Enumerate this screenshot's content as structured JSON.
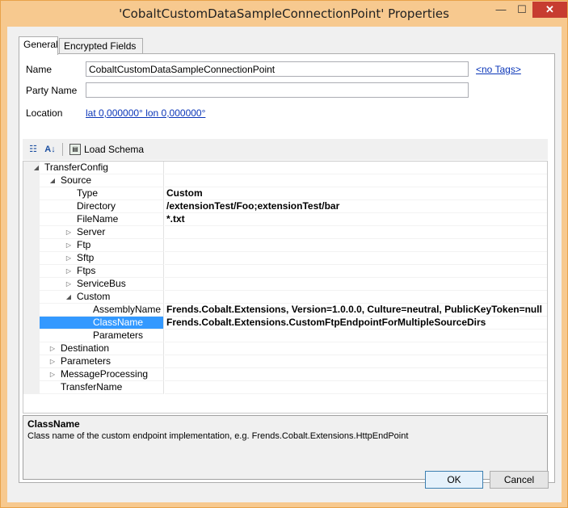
{
  "window": {
    "title": "'CobaltCustomDataSampleConnectionPoint' Properties",
    "minimize_glyph": "—",
    "maximize_glyph": "☐",
    "close_glyph": "✕"
  },
  "tabs": [
    {
      "label": "General",
      "active": true
    },
    {
      "label": "Encrypted Fields",
      "active": false
    }
  ],
  "form": {
    "name_label": "Name",
    "name_value": "CobaltCustomDataSampleConnectionPoint",
    "tags_link": "<no Tags>",
    "party_label": "Party Name",
    "party_value": "",
    "location_label": "Location",
    "location_link": "lat 0,000000°  lon 0,000000°"
  },
  "toolbar": {
    "categorized_icon": "categorized-icon",
    "alphabetical_icon": "alphabetical-sort-icon",
    "load_schema_label": "Load Schema"
  },
  "grid": {
    "rows": [
      {
        "label": "TransferConfig",
        "value": "",
        "level": 0,
        "expander": "open"
      },
      {
        "label": "Source",
        "value": "",
        "level": 1,
        "expander": "open"
      },
      {
        "label": "Type",
        "value": "Custom",
        "level": 2,
        "expander": "none"
      },
      {
        "label": "Directory",
        "value": "/extensionTest/Foo;extensionTest/bar",
        "level": 2,
        "expander": "none"
      },
      {
        "label": "FileName",
        "value": "*.txt",
        "level": 2,
        "expander": "none"
      },
      {
        "label": "Server",
        "value": "",
        "level": 2,
        "expander": "closed"
      },
      {
        "label": "Ftp",
        "value": "",
        "level": 2,
        "expander": "closed"
      },
      {
        "label": "Sftp",
        "value": "",
        "level": 2,
        "expander": "closed"
      },
      {
        "label": "Ftps",
        "value": "",
        "level": 2,
        "expander": "closed"
      },
      {
        "label": "ServiceBus",
        "value": "",
        "level": 2,
        "expander": "closed"
      },
      {
        "label": "Custom",
        "value": "",
        "level": 2,
        "expander": "open"
      },
      {
        "label": "AssemblyName",
        "value": "Frends.Cobalt.Extensions, Version=1.0.0.0, Culture=neutral, PublicKeyToken=null",
        "level": 3,
        "expander": "none"
      },
      {
        "label": "ClassName",
        "value": "Frends.Cobalt.Extensions.CustomFtpEndpointForMultipleSourceDirs",
        "level": 3,
        "expander": "none",
        "selected": true
      },
      {
        "label": "Parameters",
        "value": "",
        "level": 3,
        "expander": "none"
      },
      {
        "label": "Destination",
        "value": "",
        "level": 1,
        "expander": "closed"
      },
      {
        "label": "Parameters",
        "value": "",
        "level": 1,
        "expander": "closed"
      },
      {
        "label": "MessageProcessing",
        "value": "",
        "level": 1,
        "expander": "closed"
      },
      {
        "label": "TransferName",
        "value": "",
        "level": 1,
        "expander": "none"
      }
    ]
  },
  "description": {
    "title": "ClassName",
    "text": "Class name of the custom endpoint implementation, e.g. Frends.Cobalt.Extensions.HttpEndPoint"
  },
  "buttons": {
    "ok": "OK",
    "cancel": "Cancel"
  },
  "colors": {
    "titlebar": "#f7c98f",
    "close": "#c73c30",
    "selection": "#3399ff",
    "link": "#0b36b8"
  }
}
